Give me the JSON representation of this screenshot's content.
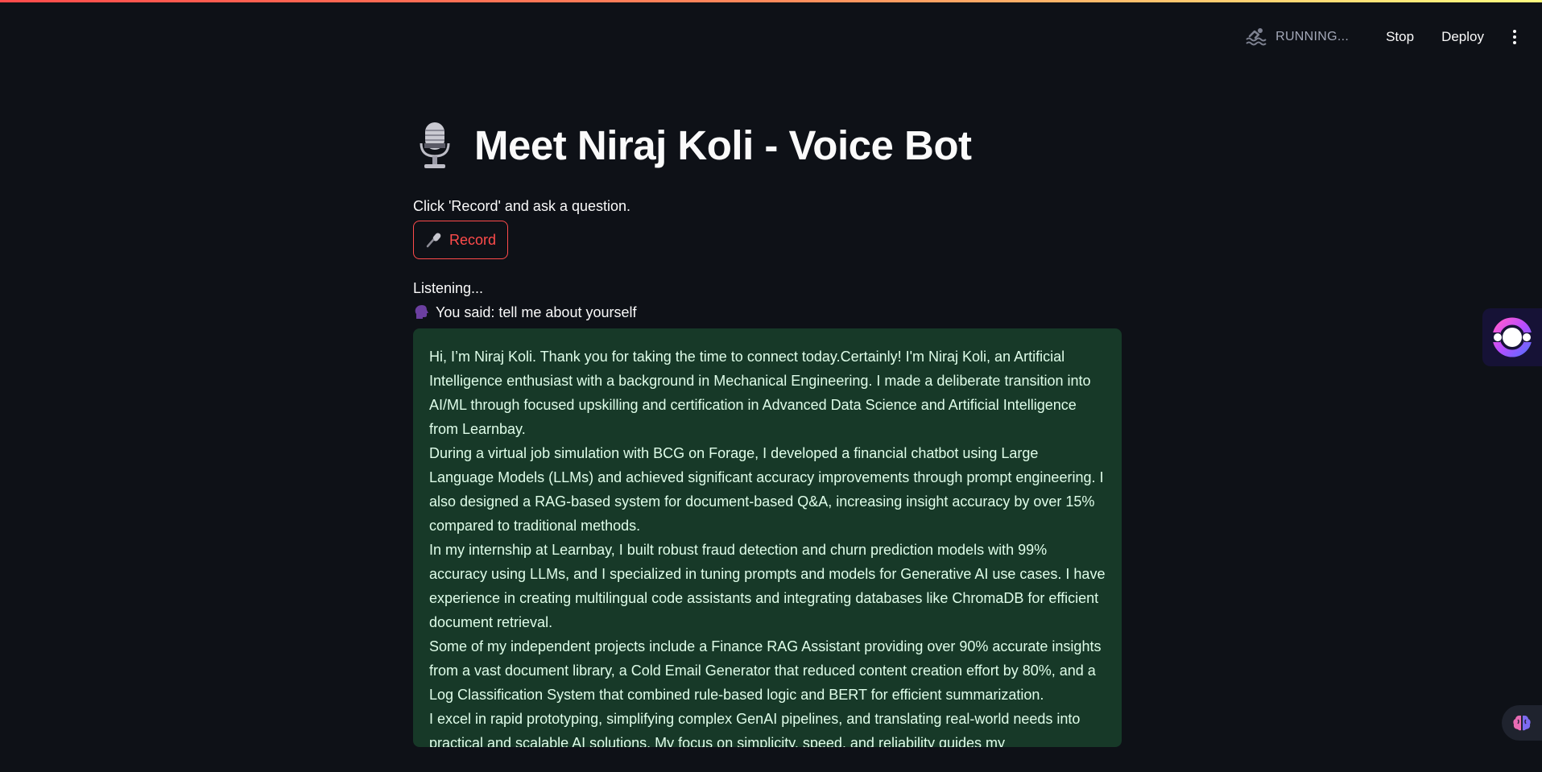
{
  "toolbar": {
    "status_text": "RUNNING...",
    "stop_label": "Stop",
    "deploy_label": "Deploy"
  },
  "header": {
    "title": "Meet Niraj Koli - Voice Bot"
  },
  "main": {
    "instruction": "Click 'Record' and ask a question.",
    "record_label": "Record",
    "listening_text": "Listening...",
    "you_said_text": "You said: tell me about yourself",
    "answer_paragraphs": [
      "Hi, I’m Niraj Koli. Thank you for taking the time to connect today.Certainly! I'm Niraj Koli, an Artificial Intelligence enthusiast with a background in Mechanical Engineering. I made a deliberate transition into AI/ML through focused upskilling and certification in Advanced Data Science and Artificial Intelligence from Learnbay.",
      "During a virtual job simulation with BCG on Forage, I developed a financial chatbot using Large Language Models (LLMs) and achieved significant accuracy improvements through prompt engineering. I also designed a RAG-based system for document-based Q&A, increasing insight accuracy by over 15% compared to traditional methods.",
      "In my internship at Learnbay, I built robust fraud detection and churn prediction models with 99% accuracy using LLMs, and I specialized in tuning prompts and models for Generative AI use cases. I have experience in creating multilingual code assistants and integrating databases like ChromaDB for efficient document retrieval.",
      "Some of my independent projects include a Finance RAG Assistant providing over 90% accurate insights from a vast document library, a Cold Email Generator that reduced content creation effort by 80%, and a Log Classification System that combined rule-based logic and BERT for efficient summarization.",
      "I excel in rapid prototyping, simplifying complex GenAI pipelines, and translating real-world needs into practical and scalable AI solutions. My focus on simplicity, speed, and reliability guides my"
    ]
  },
  "icons": {
    "status": "swimming-icon",
    "title": "studio-microphone-icon",
    "record": "microphone-icon",
    "you_said": "speaking-head-icon",
    "side_widget": "assistant-ring-icon",
    "bottom_widget": "brain-icon"
  },
  "colors": {
    "background": "#0e1117",
    "accent": "#ff4b4b",
    "answer_bg": "#173928",
    "answer_text": "#dffde9"
  }
}
